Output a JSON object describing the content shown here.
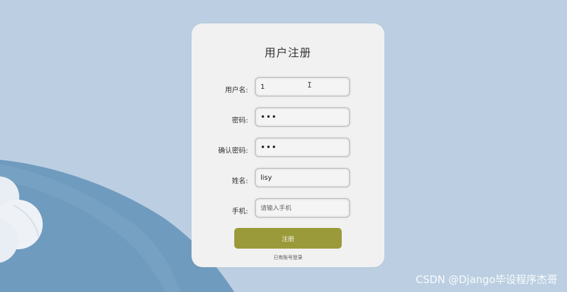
{
  "form": {
    "title": "用户注册",
    "fields": [
      {
        "label": "用户名:",
        "value": "1",
        "placeholder": ""
      },
      {
        "label": "密码:",
        "value": "•••",
        "placeholder": ""
      },
      {
        "label": "确认密码:",
        "value": "•••",
        "placeholder": ""
      },
      {
        "label": "姓名:",
        "value": "lisy",
        "placeholder": ""
      },
      {
        "label": "手机:",
        "value": "",
        "placeholder": "请输入手机"
      }
    ],
    "submit_label": "注册",
    "login_link": "已有账号登录"
  },
  "watermark": "CSDN @Django毕设程序杰哥",
  "colors": {
    "background": "#bccfe2",
    "card": "#f1f1f1",
    "button": "#9a9a3a",
    "hill": "#6f9bbf"
  },
  "icons": {
    "cursor": "text-cursor-icon"
  }
}
